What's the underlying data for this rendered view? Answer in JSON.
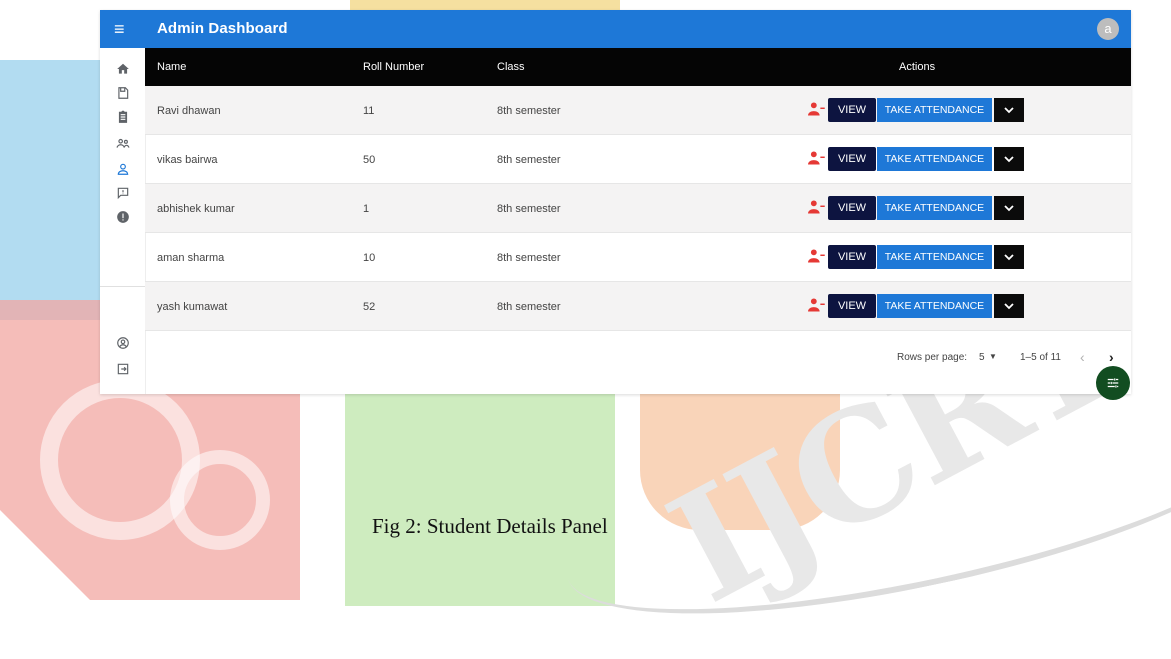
{
  "app": {
    "title": "Admin Dashboard",
    "avatar_letter": "a"
  },
  "sidebar": {
    "items": [
      {
        "icon": "home-icon"
      },
      {
        "icon": "save-icon"
      },
      {
        "icon": "clipboard-icon"
      },
      {
        "icon": "group-icon"
      },
      {
        "icon": "person-icon",
        "active": true
      },
      {
        "icon": "feedback-icon"
      },
      {
        "icon": "alert-icon"
      },
      {
        "icon": "account-circle-icon"
      },
      {
        "icon": "logout-icon"
      }
    ]
  },
  "table": {
    "headers": {
      "name": "Name",
      "roll": "Roll Number",
      "class": "Class",
      "actions": "Actions"
    },
    "rows": [
      {
        "name": "Ravi dhawan",
        "roll": "11",
        "class": "8th semester"
      },
      {
        "name": "vikas bairwa",
        "roll": "50",
        "class": "8th semester"
      },
      {
        "name": "abhishek kumar",
        "roll": "1",
        "class": "8th semester"
      },
      {
        "name": "aman sharma",
        "roll": "10",
        "class": "8th semester"
      },
      {
        "name": "yash kumawat",
        "roll": "52",
        "class": "8th semester"
      }
    ],
    "view_label": "VIEW",
    "take_label": "TAKE ATTENDANCE"
  },
  "pagination": {
    "rows_per_page_label": "Rows per page:",
    "rows_per_page_value": "5",
    "range_text": "1–5 of 11"
  },
  "caption": "Fig 2: Student Details Panel",
  "watermark": "IJCRT",
  "colors": {
    "appbar": "#1e78d7",
    "header": "#050505",
    "view": "#0d1440",
    "take": "#1e78d7",
    "fab": "#124d21",
    "remove_icon": "#e53935"
  }
}
